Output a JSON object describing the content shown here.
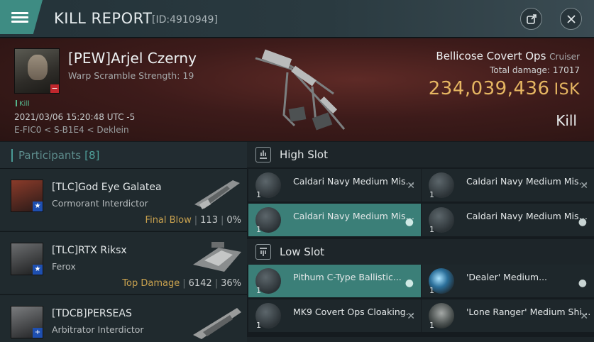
{
  "header": {
    "title": "KILL REPORT",
    "id_text": "[ID:4910949]"
  },
  "icons": {
    "menu": "hamburger-icon",
    "share": "external-link-icon",
    "close": "close-icon"
  },
  "victim": {
    "name": "[PEW]Arjel Czerny",
    "warp_scramble": "Warp Scramble Strength: 19",
    "kill_tag": "Kill",
    "datetime": "2021/03/06 15:20:48 UTC -5",
    "location": "E-FIC0 < S-B1E4 < Deklein",
    "ship_name": "Bellicose Covert Ops",
    "ship_class": "Cruiser",
    "damage_label": "Total damage:",
    "damage_value": "17017",
    "isk_value": "234,039,436",
    "isk_unit": "ISK",
    "result": "Kill"
  },
  "participants": {
    "label": "Participants",
    "count": "[8]",
    "rows": [
      {
        "name": "[TLC]God Eye Galatea",
        "ship": "Cormorant Interdictor",
        "tag": "Final Blow",
        "damage": "113",
        "percent": "0%",
        "badge": "★"
      },
      {
        "name": "[TLC]RTX Riksx",
        "ship": "Ferox",
        "tag": "Top Damage",
        "damage": "6142",
        "percent": "36%",
        "badge": "★"
      },
      {
        "name": "[TDCB]PERSEAS",
        "ship": "Arbitrator Interdictor",
        "tag": "",
        "damage": "",
        "percent": "",
        "badge": "+"
      }
    ]
  },
  "slots": {
    "high": {
      "title": "High Slot",
      "modules": [
        {
          "name": "Caldari Navy Medium Missil...",
          "qty": "1",
          "status": "dropped"
        },
        {
          "name": "Caldari Navy Medium Missil...",
          "qty": "1",
          "status": "dropped"
        },
        {
          "name": "Caldari Navy Medium Missil...",
          "qty": "1",
          "status": "destroyed"
        },
        {
          "name": "Caldari Navy Medium Missil...",
          "qty": "1",
          "status": "destroyed"
        }
      ]
    },
    "low": {
      "title": "Low Slot",
      "modules": [
        {
          "name": "Pithum C-Type Ballistic...",
          "qty": "1",
          "status": "destroyed"
        },
        {
          "name": "'Dealer' Medium...",
          "qty": "1",
          "status": "destroyed"
        },
        {
          "name": "MK9 Covert Ops Cloaking...",
          "qty": "1",
          "status": "dropped"
        },
        {
          "name": "'Lone Ranger' Medium Shiel...",
          "qty": "1",
          "status": "destroyed"
        }
      ]
    }
  },
  "colors": {
    "accent": "#3e8c83",
    "highlight_row": "#3b7f78",
    "isk": "#e6b662",
    "tag": "#c9a24f"
  }
}
